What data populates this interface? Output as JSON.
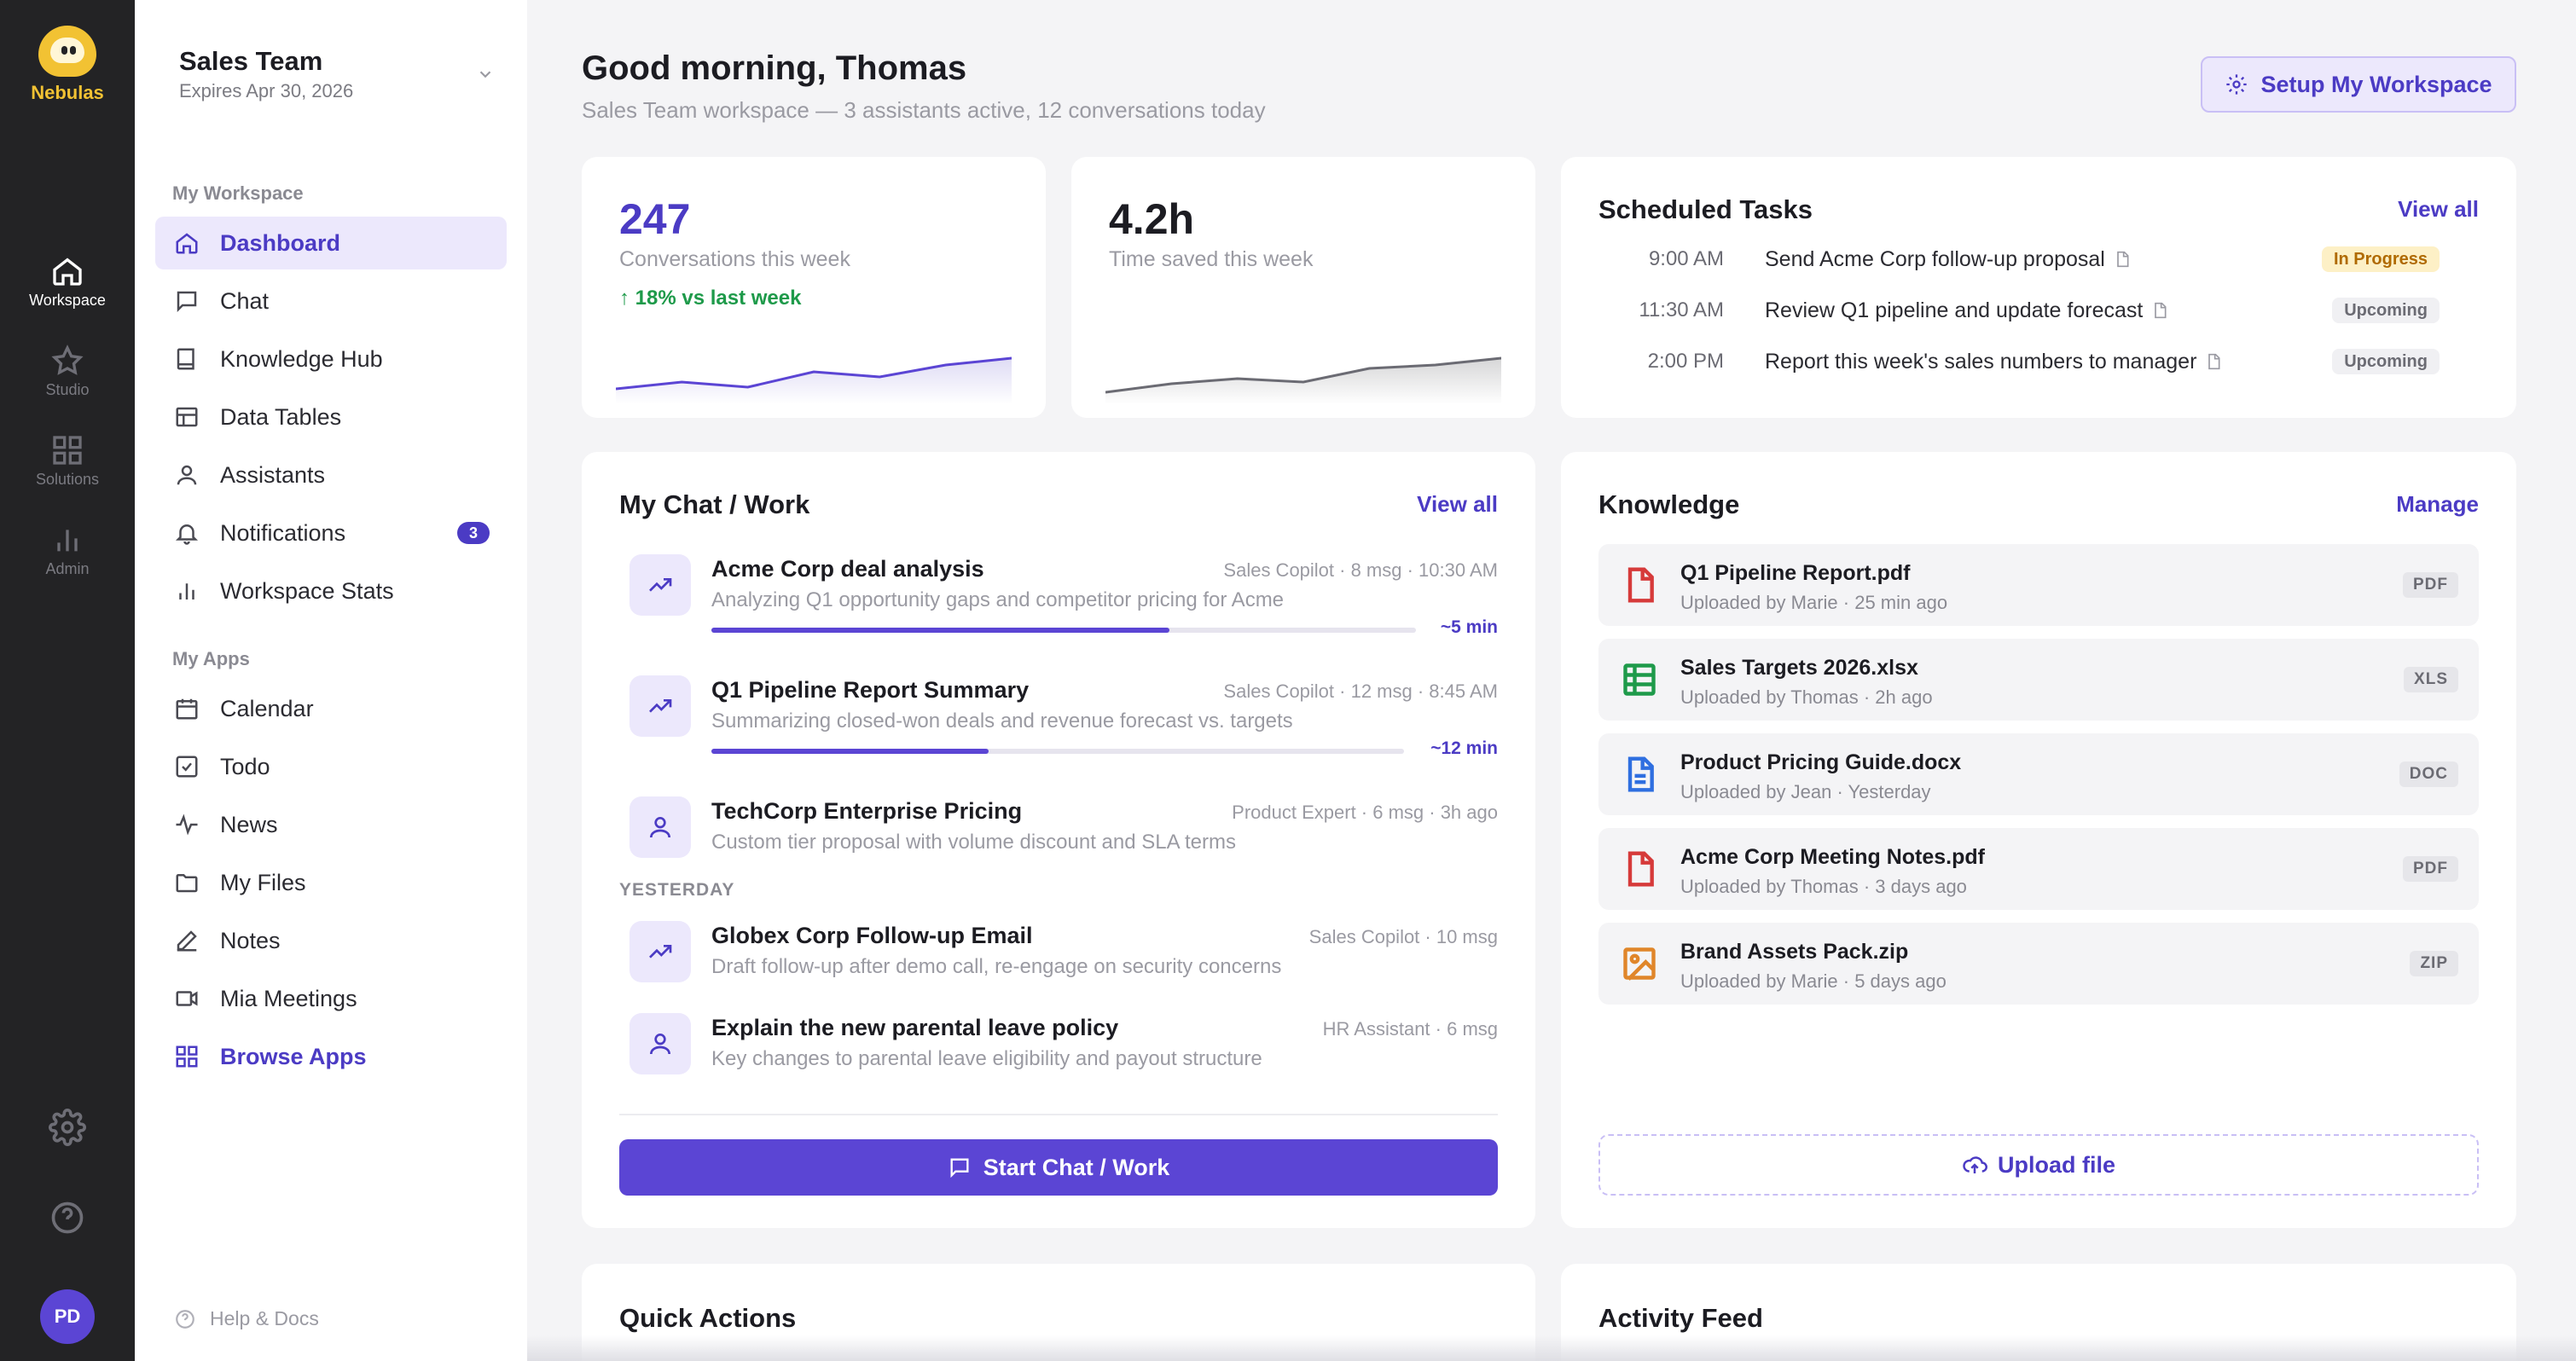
{
  "rail": {
    "brand": "Nebulas",
    "items": [
      {
        "label": "Workspace",
        "icon": "home-icon"
      },
      {
        "label": "Studio",
        "icon": "star-icon"
      },
      {
        "label": "Solutions",
        "icon": "grid-icon"
      },
      {
        "label": "Admin",
        "icon": "bar-chart-icon"
      }
    ],
    "avatar": "PD"
  },
  "sidebar": {
    "workspace_name": "Sales Team",
    "workspace_expiry": "Expires Apr 30, 2026",
    "section_workspace": "My Workspace",
    "workspace_items": [
      {
        "label": "Dashboard",
        "icon": "home-icon"
      },
      {
        "label": "Chat",
        "icon": "chat-icon"
      },
      {
        "label": "Knowledge Hub",
        "icon": "book-icon"
      },
      {
        "label": "Data Tables",
        "icon": "table-icon"
      },
      {
        "label": "Assistants",
        "icon": "user-icon"
      },
      {
        "label": "Notifications",
        "icon": "bell-icon",
        "badge": "3"
      },
      {
        "label": "Workspace Stats",
        "icon": "bar-chart-icon"
      }
    ],
    "section_apps": "My Apps",
    "app_items": [
      {
        "label": "Calendar",
        "icon": "calendar-icon"
      },
      {
        "label": "Todo",
        "icon": "checkbox-icon"
      },
      {
        "label": "News",
        "icon": "pulse-icon"
      },
      {
        "label": "My Files",
        "icon": "folder-icon"
      },
      {
        "label": "Notes",
        "icon": "edit-icon"
      },
      {
        "label": "Mia Meetings",
        "icon": "video-icon"
      },
      {
        "label": "Browse Apps",
        "icon": "apps-grid-icon"
      }
    ],
    "help": "Help & Docs"
  },
  "header": {
    "greeting": "Good morning, Thomas",
    "subtitle": "Sales Team workspace — 3 assistants active, 12 conversations today",
    "setup_button": "Setup My Workspace"
  },
  "stats": [
    {
      "value": "247",
      "label": "Conversations this week",
      "delta": "↑ 18% vs last week",
      "accent": "#4b3bc4",
      "trend": [
        3,
        5,
        3.5,
        8,
        6.5,
        10,
        12
      ]
    },
    {
      "value": "4.2h",
      "label": "Time saved this week",
      "delta": "",
      "accent": "#1c1c22",
      "trend": [
        2,
        4.5,
        6,
        5,
        9,
        10,
        12
      ]
    }
  ],
  "tasks": {
    "title": "Scheduled Tasks",
    "link": "View all",
    "items": [
      {
        "time": "9:00 AM",
        "title": "Send Acme Corp follow-up proposal",
        "status": "In Progress",
        "kind": "progress"
      },
      {
        "time": "11:30 AM",
        "title": "Review Q1 pipeline and update forecast",
        "status": "Upcoming",
        "kind": "upcoming"
      },
      {
        "time": "2:00 PM",
        "title": "Report this week's sales numbers to manager",
        "status": "Upcoming",
        "kind": "upcoming"
      }
    ]
  },
  "chat": {
    "title": "My Chat / Work",
    "link": "View all",
    "items": [
      {
        "title": "Acme Corp deal analysis",
        "meta": "Sales Copilot · 8 msg · 10:30 AM",
        "desc": "Analyzing Q1 opportunity gaps and competitor pricing for Acme",
        "icon": "trend-icon",
        "progress": 0.65,
        "eta": "~5 min"
      },
      {
        "title": "Q1 Pipeline Report Summary",
        "meta": "Sales Copilot · 12 msg · 8:45 AM",
        "desc": "Summarizing closed-won deals and revenue forecast vs. targets",
        "icon": "trend-icon",
        "progress": 0.4,
        "eta": "~12 min"
      },
      {
        "title": "TechCorp Enterprise Pricing",
        "meta": "Product Expert · 6 msg · 3h ago",
        "desc": "Custom tier proposal with volume discount and SLA terms",
        "icon": "user-icon"
      },
      {
        "title": "Globex Corp Follow-up Email",
        "meta": "Sales Copilot · 10 msg",
        "desc": "Draft follow-up after demo call, re-engage on security concerns",
        "icon": "trend-icon"
      },
      {
        "title": "Explain the new parental leave policy",
        "meta": "HR Assistant · 6 msg",
        "desc": "Key changes to parental leave eligibility and payout structure",
        "icon": "user-icon"
      }
    ],
    "yesterday": "YESTERDAY",
    "button": "Start Chat / Work"
  },
  "knowledge": {
    "title": "Knowledge",
    "link": "Manage",
    "files": [
      {
        "name": "Q1 Pipeline Report.pdf",
        "meta": "Uploaded by Marie · 25 min ago",
        "tag": "PDF",
        "icon": "pdf-file-icon",
        "color": "#d63a3a"
      },
      {
        "name": "Sales Targets 2026.xlsx",
        "meta": "Uploaded by Thomas · 2h ago",
        "tag": "XLS",
        "icon": "spreadsheet-icon",
        "color": "#1e9a4a"
      },
      {
        "name": "Product Pricing Guide.docx",
        "meta": "Uploaded by Jean · Yesterday",
        "tag": "DOC",
        "icon": "doc-file-icon",
        "color": "#2f6fe0"
      },
      {
        "name": "Acme Corp Meeting Notes.pdf",
        "meta": "Uploaded by Thomas · 3 days ago",
        "tag": "PDF",
        "icon": "pdf-file-icon",
        "color": "#d63a3a"
      },
      {
        "name": "Brand Assets Pack.zip",
        "meta": "Uploaded by Marie · 5 days ago",
        "tag": "ZIP",
        "icon": "image-file-icon",
        "color": "#e0862a"
      }
    ],
    "upload": "Upload file"
  },
  "quick_actions": {
    "title": "Quick Actions"
  },
  "activity": {
    "title": "Activity Feed"
  }
}
